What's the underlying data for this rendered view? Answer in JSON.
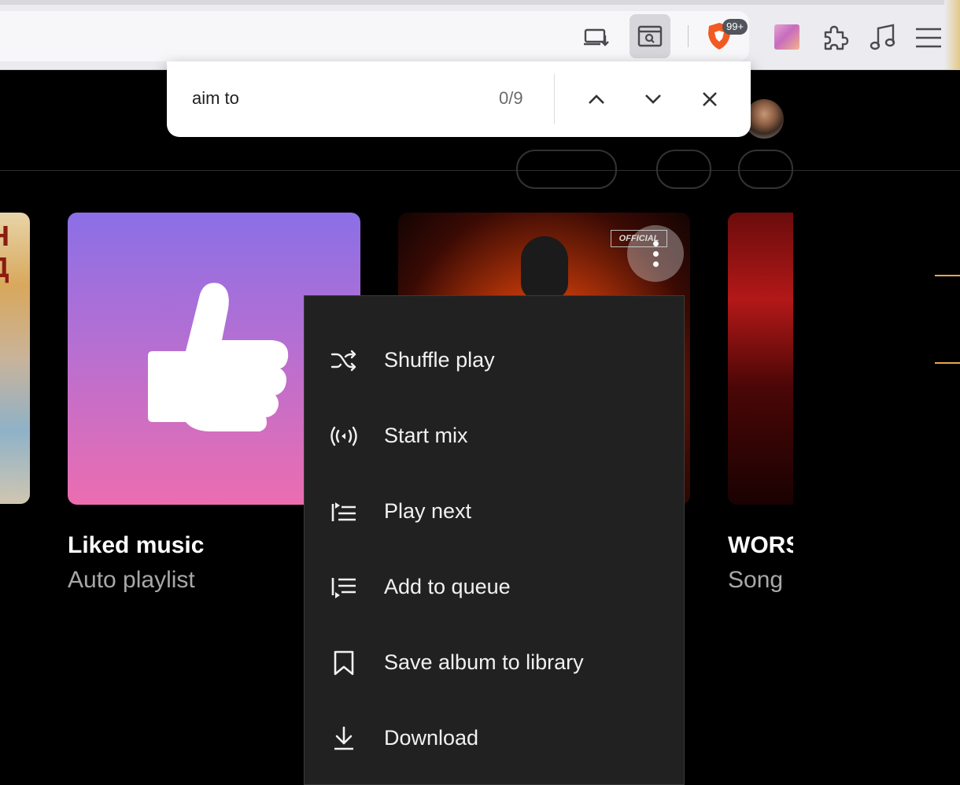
{
  "find_bar": {
    "query": "aim to",
    "match_count": "0/9"
  },
  "browser": {
    "notification_badge": "99+"
  },
  "cards": [
    {
      "title": "Liked music",
      "subtitle": "Auto playlist"
    },
    {
      "title": "WORS",
      "subtitle": "Song"
    }
  ],
  "album_art": {
    "badge_text": "OFFICIAL"
  },
  "context_menu": {
    "items": [
      {
        "label": "Shuffle play",
        "icon": "shuffle-icon"
      },
      {
        "label": "Start mix",
        "icon": "radio-icon"
      },
      {
        "label": "Play next",
        "icon": "play-next-icon"
      },
      {
        "label": "Add to queue",
        "icon": "add-to-queue-icon"
      },
      {
        "label": "Save album to library",
        "icon": "bookmark-icon"
      },
      {
        "label": "Download",
        "icon": "download-icon"
      }
    ]
  },
  "colors": {
    "page_background": "#000000",
    "menu_background": "#212121",
    "liked_gradient_top": "#8b6fe6",
    "liked_gradient_bottom": "#ec6db0",
    "accent": "#e8a84a"
  }
}
